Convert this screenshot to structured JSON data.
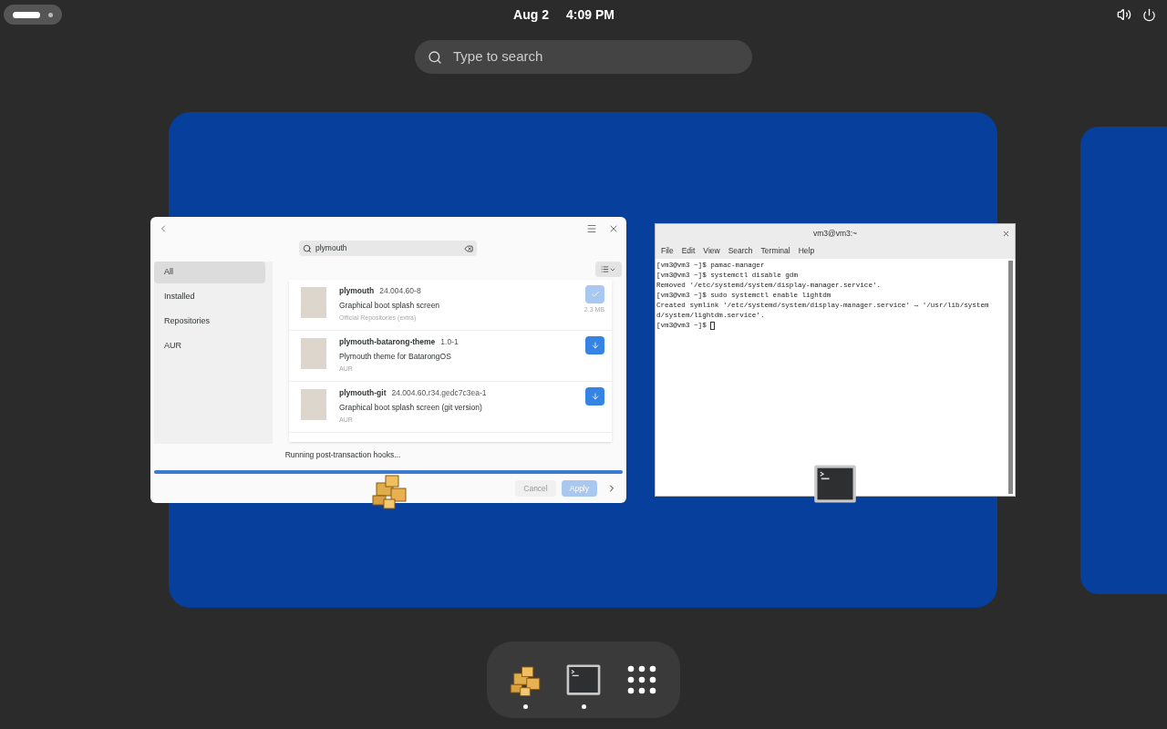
{
  "top_bar": {
    "date": "Aug 2",
    "time": "4:09 PM"
  },
  "search": {
    "placeholder": "Type to search"
  },
  "pamac": {
    "search_value": "plymouth",
    "sidebar": [
      {
        "label": "All",
        "selected": true
      },
      {
        "label": "Installed",
        "selected": false
      },
      {
        "label": "Repositories",
        "selected": false
      },
      {
        "label": "AUR",
        "selected": false
      }
    ],
    "packages": [
      {
        "name": "plymouth",
        "version": "24.004.60-8",
        "description": "Graphical boot splash screen",
        "source": "Official Repositories (extra)",
        "size": "2.3 MB",
        "installed": true
      },
      {
        "name": "plymouth-batarong-theme",
        "version": "1.0-1",
        "description": "Plymouth theme for BatarongOS",
        "source": "AUR",
        "installed": false
      },
      {
        "name": "plymouth-git",
        "version": "24.004.60.r34.gedc7c3ea-1",
        "description": "Graphical boot splash screen (git version)",
        "source": "AUR",
        "installed": false
      }
    ],
    "status": "Running post-transaction hooks...",
    "progress": {
      "level": 1
    },
    "buttons": [
      {
        "label": "Cancel",
        "disabled": true
      },
      {
        "label": "Apply",
        "disabled": true
      }
    ]
  },
  "terminal": {
    "title": "vm3@vm3:~",
    "menu": [
      "File",
      "Edit",
      "View",
      "Search",
      "Terminal",
      "Help"
    ],
    "lines": [
      "[vm3@vm3 ~]$ pamac-manager",
      "[vm3@vm3 ~]$ systemctl disable gdm",
      "Removed '/etc/systemd/system/display-manager.service'.",
      "[vm3@vm3 ~]$ sudo systemctl enable lightdm",
      "Created symlink '/etc/systemd/system/display-manager.service' → '/usr/lib/system",
      "d/system/lightdm.service'.",
      "[vm3@vm3 ~]$ "
    ]
  },
  "dock": [
    {
      "kind": "package-manager",
      "running": true
    },
    {
      "kind": "terminal",
      "running": true
    },
    {
      "kind": "app-grid",
      "running": false
    }
  ]
}
